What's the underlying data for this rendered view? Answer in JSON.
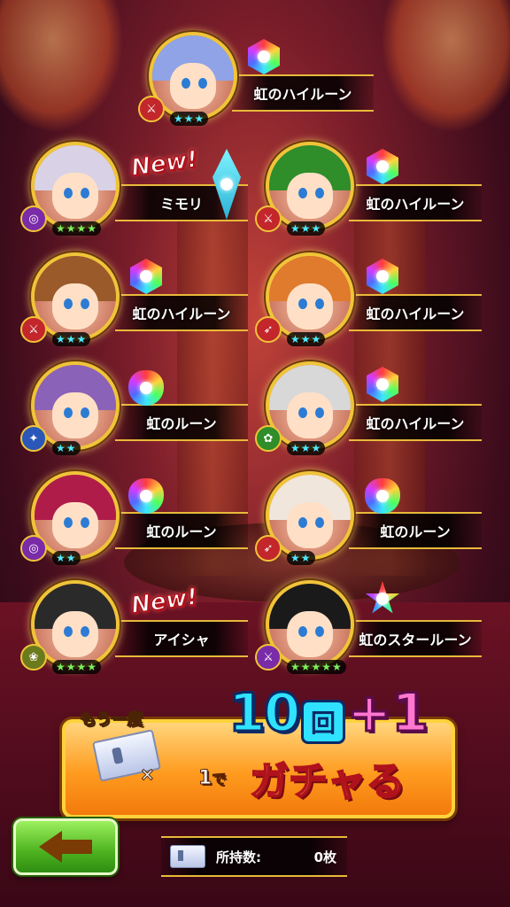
{
  "results": [
    {
      "id": "c1",
      "name": "虹のハイルーン",
      "rarity": "★★★",
      "star_color": "blue",
      "new": false,
      "rune": "hex",
      "hair": "#8fa3e6",
      "type_color": "#c3262b",
      "type_glyph": "⚔"
    },
    {
      "id": "c2",
      "name": "ミモリ",
      "rarity": "★★★★",
      "star_color": "green",
      "new": true,
      "new_label": "New!",
      "rune": "crystal",
      "hair": "#d9d2e6",
      "type_color": "#7a2ba8",
      "type_glyph": "◎"
    },
    {
      "id": "c3",
      "name": "虹のハイルーン",
      "rarity": "★★★",
      "star_color": "blue",
      "new": false,
      "rune": "hex",
      "hair": "#2f8d2a",
      "type_color": "#c3262b",
      "type_glyph": "⚔"
    },
    {
      "id": "c4",
      "name": "虹のハイルーン",
      "rarity": "★★★",
      "star_color": "blue",
      "new": false,
      "rune": "hex",
      "hair": "#9a5a2a",
      "type_color": "#c3262b",
      "type_glyph": "⚔"
    },
    {
      "id": "c5",
      "name": "虹のハイルーン",
      "rarity": "★★★",
      "star_color": "blue",
      "new": false,
      "rune": "hex",
      "hair": "#e07a2c",
      "type_color": "#c3262b",
      "type_glyph": "➶"
    },
    {
      "id": "c6",
      "name": "虹のルーン",
      "rarity": "★★",
      "star_color": "blue",
      "new": false,
      "rune": "round",
      "hair": "#8a62b8",
      "type_color": "#2a57b8",
      "type_glyph": "✦"
    },
    {
      "id": "c7",
      "name": "虹のハイルーン",
      "rarity": "★★★",
      "star_color": "blue",
      "new": false,
      "rune": "hex",
      "hair": "#d8d8d8",
      "type_color": "#2f8d2a",
      "type_glyph": "✿"
    },
    {
      "id": "c8",
      "name": "虹のルーン",
      "rarity": "★★",
      "star_color": "blue",
      "new": false,
      "rune": "round",
      "hair": "#b01c4a",
      "type_color": "#7a2ba8",
      "type_glyph": "◎"
    },
    {
      "id": "c9",
      "name": "虹のルーン",
      "rarity": "★★",
      "star_color": "blue",
      "new": false,
      "rune": "round",
      "hair": "#f0e6dc",
      "type_color": "#c3262b",
      "type_glyph": "➶"
    },
    {
      "id": "c10",
      "name": "アイシャ",
      "rarity": "★★★★",
      "star_color": "green",
      "new": true,
      "new_label": "New!",
      "rune": "none",
      "hair": "#2a2a2a",
      "type_color": "#6b7a1c",
      "type_glyph": "❀"
    },
    {
      "id": "c11",
      "name": "虹のスタールーン",
      "rarity": "★★★★★",
      "star_color": "green",
      "new": false,
      "rune": "star",
      "hair": "#1a1a1a",
      "type_color": "#7a2ba8",
      "type_glyph": "⚔"
    }
  ],
  "gacha_button": {
    "again_label": "もう一度",
    "times_symbol": "×",
    "count_big": "10",
    "kai": "回",
    "plus": "+1",
    "cost": "1",
    "de": "で",
    "action": "ガチャる"
  },
  "owned": {
    "label": "所持数:",
    "value": "0枚"
  }
}
